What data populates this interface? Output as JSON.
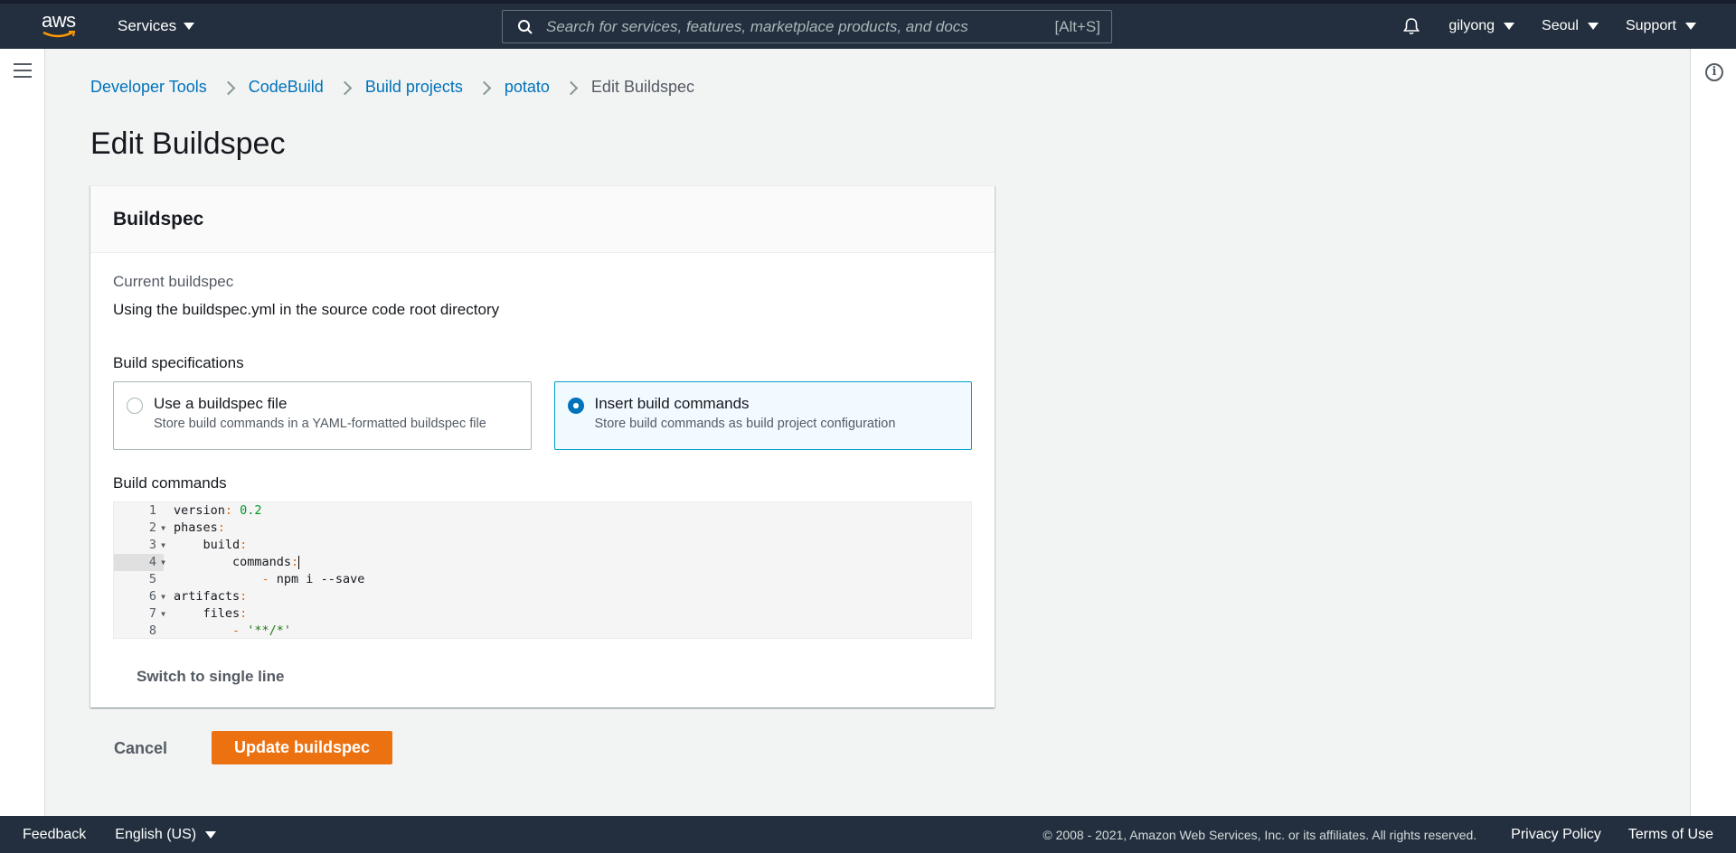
{
  "nav": {
    "logo_text": "aws",
    "services_label": "Services",
    "search_placeholder": "Search for services, features, marketplace products, and docs",
    "search_shortcut": "[Alt+S]",
    "user": "gilyong",
    "region": "Seoul",
    "support": "Support"
  },
  "breadcrumb": {
    "items": [
      "Developer Tools",
      "CodeBuild",
      "Build projects",
      "potato"
    ],
    "current": "Edit Buildspec"
  },
  "page_title": "Edit Buildspec",
  "panel": {
    "title": "Buildspec",
    "current_label": "Current buildspec",
    "current_value": "Using the buildspec.yml in the source code root directory",
    "specs_label": "Build specifications",
    "options": [
      {
        "title": "Use a buildspec file",
        "desc": "Store build commands in a YAML-formatted buildspec file",
        "selected": false
      },
      {
        "title": "Insert build commands",
        "desc": "Store build commands as build project configuration",
        "selected": true
      }
    ],
    "commands_label": "Build commands",
    "code_lines": [
      {
        "n": "1",
        "text": "version: 0.2"
      },
      {
        "n": "2",
        "text": "phases:"
      },
      {
        "n": "3",
        "text": "    build:"
      },
      {
        "n": "4",
        "text": "        commands:"
      },
      {
        "n": "5",
        "text": "            - npm i --save"
      },
      {
        "n": "6",
        "text": "artifacts:"
      },
      {
        "n": "7",
        "text": "    files:"
      },
      {
        "n": "8",
        "text": "        - '**/*'"
      }
    ],
    "switch_label": "Switch to single line"
  },
  "actions": {
    "cancel": "Cancel",
    "update": "Update buildspec"
  },
  "footer": {
    "feedback": "Feedback",
    "language": "English (US)",
    "copyright": "© 2008 - 2021, Amazon Web Services, Inc. or its affiliates. All rights reserved.",
    "privacy": "Privacy Policy",
    "terms": "Terms of Use"
  },
  "colors": {
    "nav_bg": "#232f3e",
    "link": "#0073bb",
    "primary_button": "#ec7211",
    "selected_border": "#00a1c9"
  }
}
